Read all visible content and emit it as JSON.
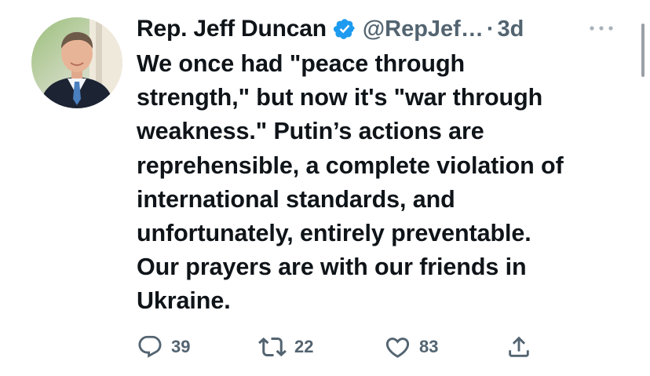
{
  "tweet": {
    "author": {
      "display_name": "Rep. Jeff Duncan",
      "handle": "@RepJef…",
      "verified": true
    },
    "separator": "·",
    "timestamp": "3d",
    "text": "We once had \"peace through\nstrength,\" but now it's \"war through\nweakness.\" Putin’s actions are\nreprehensible, a complete violation of\ninternational standards, and\nunfortunately, entirely preventable.\nOur prayers are with our friends in\nUkraine.",
    "actions": {
      "reply_count": "39",
      "retweet_count": "22",
      "like_count": "83"
    }
  },
  "colors": {
    "text": "#0f1419",
    "secondary": "#536471",
    "verified_badge": "#1d9bf0"
  },
  "icons": [
    "verified-badge-icon",
    "more-icon",
    "reply-icon",
    "retweet-icon",
    "like-icon",
    "share-icon"
  ]
}
